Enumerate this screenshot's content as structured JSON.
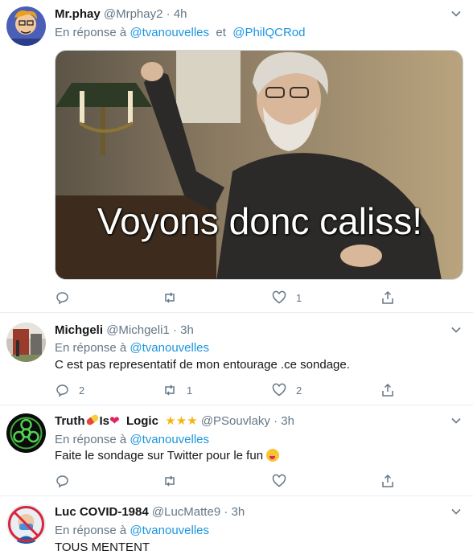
{
  "reply_prefix": "En réponse à",
  "and_word": "et",
  "tweets": [
    {
      "name": "Mr.phay",
      "handle": "@Mrphay2",
      "time": "4h",
      "mentions": [
        "@tvanouvelles",
        "@PhilQCRod"
      ],
      "media_caption": "Voyons donc caliss!",
      "replies": "",
      "retweets": "",
      "likes": "1"
    },
    {
      "name": "Michgeli",
      "handle": "@Michgeli1",
      "time": "3h",
      "mentions": [
        "@tvanouvelles"
      ],
      "text": "C est pas representatif de mon entourage .ce sondage.",
      "replies": "2",
      "retweets": "1",
      "likes": "2"
    },
    {
      "name_parts": [
        "Truth",
        "Is",
        "Logic"
      ],
      "handle": "@PSouvlaky",
      "time": "3h",
      "mentions": [
        "@tvanouvelles"
      ],
      "text": "Faite le sondage sur Twitter pour le fun",
      "replies": "",
      "retweets": "",
      "likes": ""
    },
    {
      "name": "Luc COVID-1984",
      "handle": "@LucMatte9",
      "time": "3h",
      "mentions": [
        "@tvanouvelles"
      ],
      "text": "TOUS MENTENT"
    }
  ],
  "colors": {
    "link": "#1b95e0",
    "secondary": "#657786",
    "border": "#e6ecf0"
  }
}
